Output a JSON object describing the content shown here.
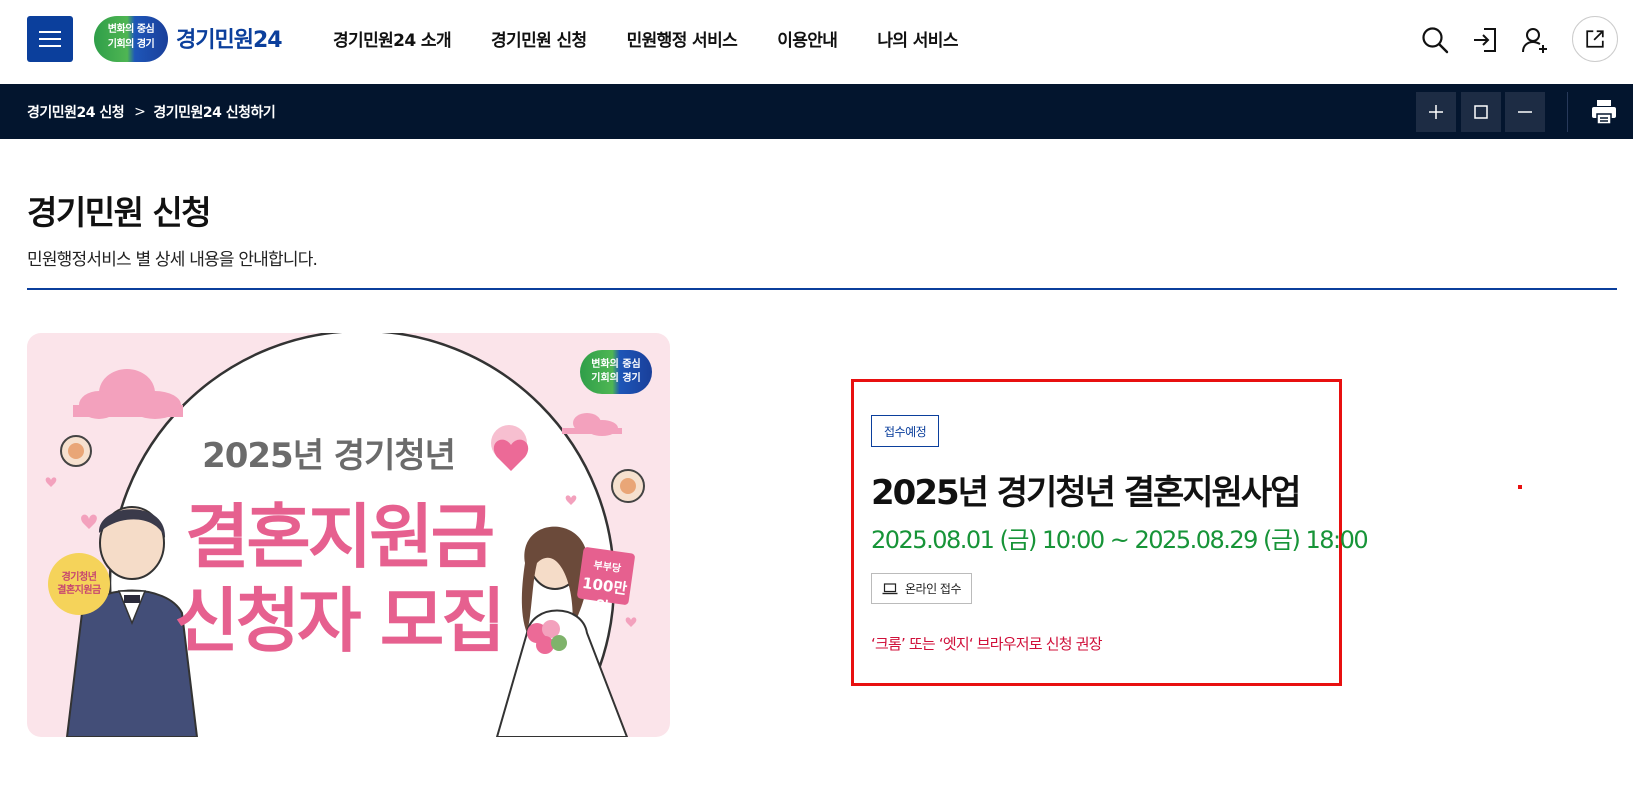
{
  "header": {
    "logo_badge_line1": "변화의 중심",
    "logo_badge_line2": "기회의 경기",
    "logo_text": "경기민원24",
    "nav": [
      "경기민원24 소개",
      "경기민원 신청",
      "민원행정 서비스",
      "이용안내",
      "나의 서비스"
    ],
    "icons": [
      "search-icon",
      "login-icon",
      "signup-icon",
      "external-link-icon"
    ]
  },
  "breadcrumb": {
    "items": [
      "경기민원24 신청",
      "경기민원24 신청하기"
    ],
    "separator": ">"
  },
  "page": {
    "title": "경기민원 신청",
    "description": "민원행정서비스 별 상세 내용을 안내합니다."
  },
  "banner": {
    "line1": "2025년 경기청년",
    "line2": "결혼지원금",
    "line3": "신청자 모집",
    "badge_line1": "변화의 중심",
    "badge_line2": "기회의 경기",
    "sign_line1": "경기청년",
    "sign_line2": "결혼지원금",
    "card_line1": "부부당",
    "card_line2": "100만원"
  },
  "info": {
    "status": "접수예정",
    "title": "2025년 경기청년 결혼지원사업",
    "period": "2025.08.01 (금) 10:00 ~ 2025.08.29 (금) 18:00",
    "online_label": "온라인 접수",
    "notice": "‘크롬’ 또는 ‘엣지‘ 브라우저로 신청 권장"
  },
  "colors": {
    "brand_blue": "#0b3f9c",
    "nav_bar": "#03152e",
    "period_green": "#179438",
    "notice_red": "#d0103a",
    "highlight_red": "#e81010",
    "banner_pink": "#e6608f"
  }
}
